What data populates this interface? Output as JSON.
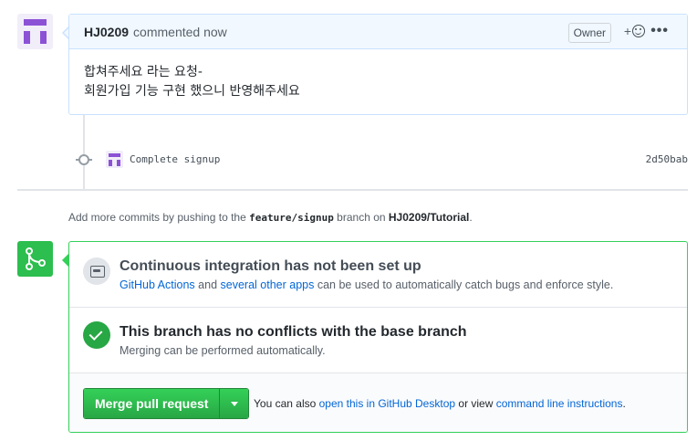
{
  "comment": {
    "author": "HJ0209",
    "action": "commented now",
    "badge": "Owner",
    "react_plus": "+",
    "menu": "•••",
    "body_line1": "합쳐주세요 라는 요청-",
    "body_line2": "회원가입 기능 구현 했으니 반영해주세요"
  },
  "commit": {
    "message": "Complete signup",
    "sha": "2d50bab"
  },
  "hint": {
    "prefix": "Add more commits by pushing to the",
    "branch": "feature/signup",
    "middle": "branch on",
    "repo": "HJ0209/Tutorial",
    "suffix": "."
  },
  "ci": {
    "title": "Continuous integration has not been set up",
    "link1": "GitHub Actions",
    "and": "and",
    "link2": "several other apps",
    "rest": "can be used to automatically catch bugs and enforce style."
  },
  "conflicts": {
    "title": "This branch has no conflicts with the base branch",
    "subtitle": "Merging can be performed automatically."
  },
  "merge": {
    "button_label": "Merge pull request",
    "also_prefix": "You can also",
    "link_desktop": "open this in GitHub Desktop",
    "or_view": "or view",
    "link_cli": "command line instructions",
    "suffix": "."
  },
  "colors": {
    "accent_green": "#2cbe4e",
    "link_blue": "#0366d6",
    "avatar_purple": "#8c52d6"
  },
  "icons": [
    "avatar-identicon",
    "smiley-icon",
    "kebab-icon",
    "commit-icon",
    "merge-icon",
    "ci-icon",
    "check-icon",
    "caret-down-icon"
  ]
}
